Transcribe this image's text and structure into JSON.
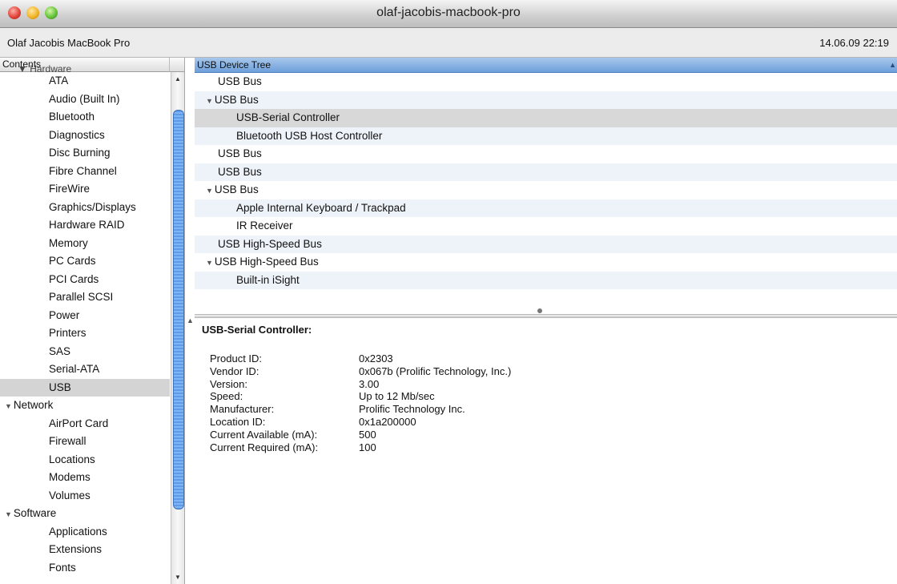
{
  "window": {
    "title": "olaf-jacobis-macbook-pro"
  },
  "info": {
    "machine_name": "Olaf Jacobis MacBook Pro",
    "datetime": "14.06.09 22:19"
  },
  "sidebar": {
    "header": "Contents",
    "hidden_partial": "Hardware",
    "hardware_items": [
      "ATA",
      "Audio (Built In)",
      "Bluetooth",
      "Diagnostics",
      "Disc Burning",
      "Fibre Channel",
      "FireWire",
      "Graphics/Displays",
      "Hardware RAID",
      "Memory",
      "PC Cards",
      "PCI Cards",
      "Parallel SCSI",
      "Power",
      "Printers",
      "SAS",
      "Serial-ATA",
      "USB"
    ],
    "network_label": "Network",
    "network_items": [
      "AirPort Card",
      "Firewall",
      "Locations",
      "Modems",
      "Volumes"
    ],
    "software_label": "Software",
    "software_items": [
      "Applications",
      "Extensions",
      "Fonts"
    ],
    "selected": "USB"
  },
  "tree": {
    "header": "USB Device Tree",
    "rows": [
      {
        "label": "USB Bus",
        "level": 0,
        "expanded": false
      },
      {
        "label": "USB Bus",
        "level": 0,
        "expanded": true
      },
      {
        "label": "USB-Serial Controller",
        "level": 1,
        "selected": true
      },
      {
        "label": "Bluetooth USB Host Controller",
        "level": 1
      },
      {
        "label": "USB Bus",
        "level": 0,
        "expanded": false
      },
      {
        "label": "USB Bus",
        "level": 0,
        "expanded": false
      },
      {
        "label": "USB Bus",
        "level": 0,
        "expanded": true
      },
      {
        "label": "Apple Internal Keyboard / Trackpad",
        "level": 1
      },
      {
        "label": "IR Receiver",
        "level": 1
      },
      {
        "label": "USB High-Speed Bus",
        "level": 0,
        "expanded": false
      },
      {
        "label": "USB High-Speed Bus",
        "level": 0,
        "expanded": true
      },
      {
        "label": "Built-in iSight",
        "level": 1
      }
    ]
  },
  "detail": {
    "title": "USB-Serial Controller:",
    "rows": [
      {
        "label": "Product ID:",
        "value": "0x2303"
      },
      {
        "label": "Vendor ID:",
        "value": "0x067b  (Prolific Technology, Inc.)"
      },
      {
        "label": "Version:",
        "value": "3.00"
      },
      {
        "label": "Speed:",
        "value": "Up to 12 Mb/sec"
      },
      {
        "label": "Manufacturer:",
        "value": "Prolific Technology Inc."
      },
      {
        "label": "Location ID:",
        "value": "0x1a200000"
      },
      {
        "label": "Current Available (mA):",
        "value": "500"
      },
      {
        "label": "Current Required (mA):",
        "value": "100"
      }
    ]
  },
  "colors": {
    "tree_header": "#7fa9de",
    "selection": "#d4d4d4",
    "scroll_thumb": "#6ea7ee"
  }
}
